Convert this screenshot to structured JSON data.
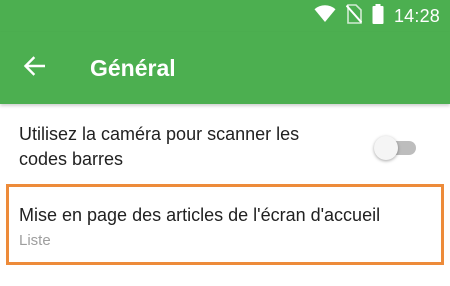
{
  "status_bar": {
    "time": "14:28",
    "icons": [
      "wifi-icon",
      "no-sim-icon",
      "battery-icon"
    ]
  },
  "app_bar": {
    "title": "Général",
    "back_icon": "arrow-back-icon"
  },
  "settings": {
    "camera_scan": {
      "label": "Utilisez la caméra pour scanner les codes barres",
      "enabled": false
    },
    "home_layout": {
      "title": "Mise en page des articles de l'écran d'accueil",
      "value": "Liste"
    }
  },
  "colors": {
    "primary": "#4caf50",
    "highlight": "#ed8b3a",
    "text_primary": "#212121",
    "text_secondary": "#9e9e9e"
  }
}
